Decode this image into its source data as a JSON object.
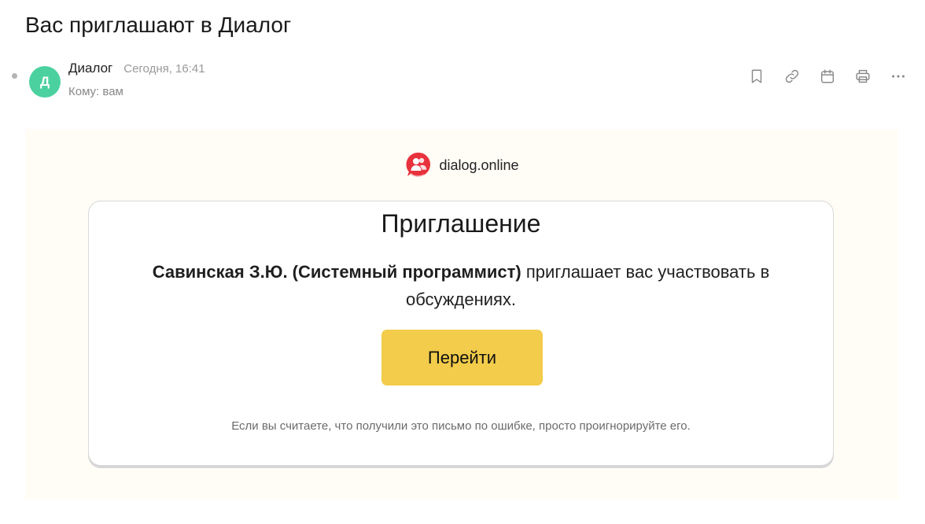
{
  "email": {
    "subject": "Вас приглашают в Диалог",
    "avatar_letter": "Д",
    "sender_name": "Диалог",
    "date": "Сегодня, 16:41",
    "recipient": "Кому: вам"
  },
  "toolbar": {
    "icons": [
      "bookmark-icon",
      "link-icon",
      "calendar-icon",
      "print-icon",
      "more-icon"
    ]
  },
  "body": {
    "brand_name": "dialog.online",
    "card": {
      "title": "Приглашение",
      "inviter": "Савинская З.Ю. (Системный программист)",
      "message_rest": " приглашает вас участвовать в обсуждениях.",
      "button_label": "Перейти",
      "footnote": "Если вы считаете, что получили это письмо по ошибке, просто проигнорируйте его."
    }
  },
  "colors": {
    "avatar": "#4bd1a0",
    "body_background": "#fffdf6",
    "button": "#f2cc4a",
    "brand_logo": "#e8323c"
  }
}
